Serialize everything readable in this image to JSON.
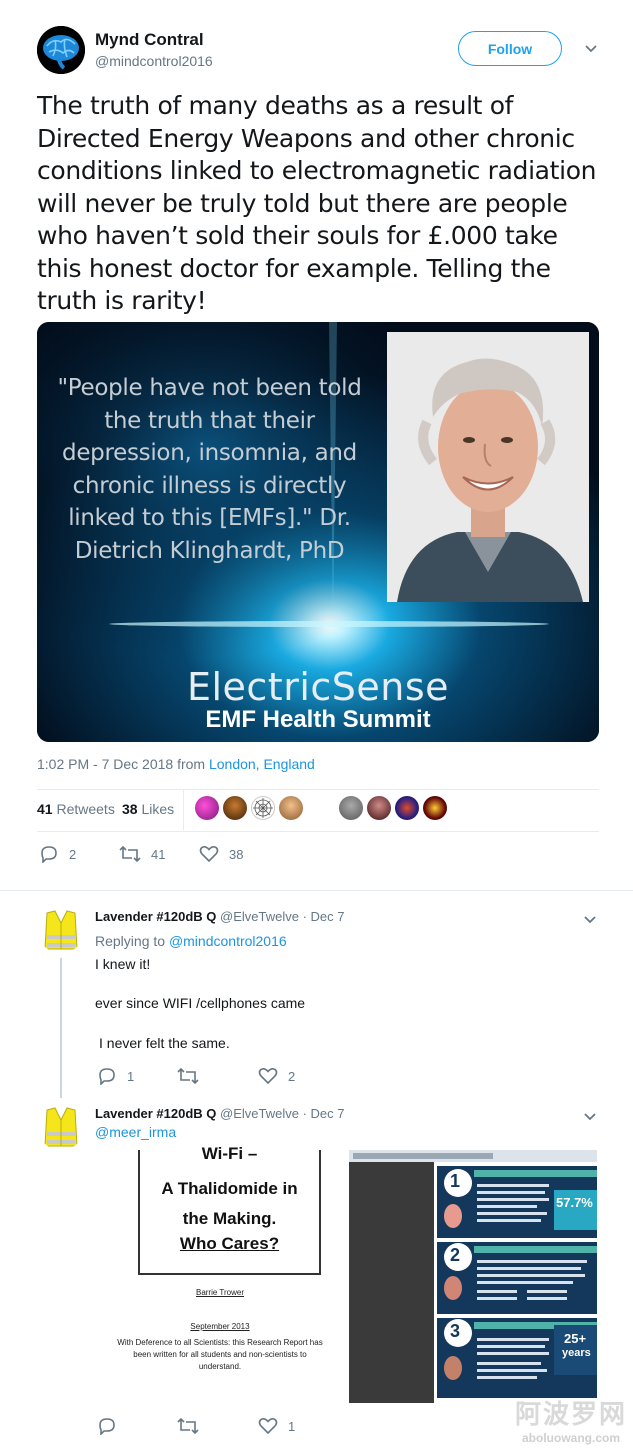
{
  "author": {
    "name": "Mynd Contral",
    "handle": "@mindcontrol2016",
    "follow_label": "Follow"
  },
  "tweet": {
    "text": "The truth of many deaths as a result of Directed Energy Weapons and other chronic conditions linked to electromagnetic radiation will never be truly told but there are people who haven’t sold their souls for £.000 take this honest doctor for example. Telling the truth is rarity!",
    "timestamp": "1:02 PM - 7 Dec 2018 from ",
    "location": "London, England"
  },
  "media": {
    "quote": "\"People have not been told the truth that their depression, insomnia, and chronic illness is directly linked to this [EMFs].\" Dr. Dietrich Klinghardt, PhD",
    "brand_line1": "ElectricSense",
    "brand_line2": "EMF Health Summit"
  },
  "stats": {
    "retweets_count": "41",
    "retweets_label": " Retweets",
    "likes_count": "38",
    "likes_label": " Likes"
  },
  "actions": {
    "reply_count": "2",
    "retweet_count": "41",
    "like_count": "38"
  },
  "replies": [
    {
      "name": "Lavender #120dB Q",
      "handle": "@ElveTwelve",
      "date": "· Dec 7",
      "replying_prefix": "Replying to ",
      "replying_to": "@mindcontrol2016",
      "line1": "I knew it!",
      "line2": "ever since WIFI /cellphones came",
      "line3": "I never felt the same.",
      "reply_count": "1",
      "retweet_count": "",
      "like_count": "2"
    },
    {
      "name": "Lavender #120dB Q",
      "handle": "@ElveTwelve",
      "date": "· Dec 7",
      "mention": "@meer_irma",
      "reply_count": "",
      "retweet_count": "",
      "like_count": "1"
    }
  ],
  "document": {
    "title1": "Wi-Fi –",
    "title2a": "A Thalidomide in",
    "title2b": "the Making.",
    "title3": "Who Cares?",
    "author": "Barrie Trower",
    "date": "September 2013",
    "dedication1": "With Deference to all Scientists: this Research Report has",
    "dedication2": "been written for all students and non-scientists to",
    "dedication3": "understand."
  },
  "infographic": {
    "pct1": "57.7%",
    "pct2a": "25+",
    "pct2b": "years",
    "num1": "1",
    "num2": "2",
    "num3": "3"
  },
  "watermark": {
    "cn": "阿波罗网",
    "url": "aboluowang.com"
  },
  "colors": {
    "link": "#1b95e0",
    "accent": "#1da1f2",
    "muted": "#657786",
    "text": "#14171a"
  }
}
